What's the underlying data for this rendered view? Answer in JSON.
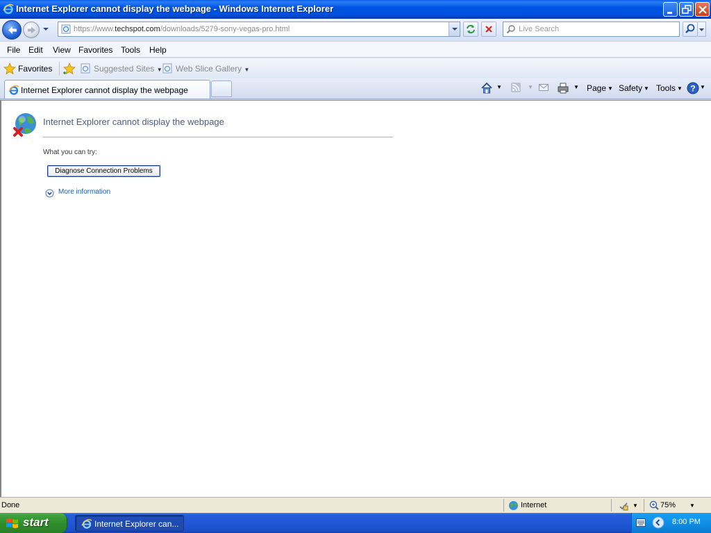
{
  "window": {
    "title": "Internet Explorer cannot display the webpage - Windows Internet Explorer"
  },
  "address": {
    "url_prefix": "https://www.",
    "url_domain": "techspot.com",
    "url_path": "/downloads/5279-sony-vegas-pro.html"
  },
  "search": {
    "placeholder": "Live Search"
  },
  "menu": {
    "items": [
      "File",
      "Edit",
      "View",
      "Favorites",
      "Tools",
      "Help"
    ]
  },
  "favorites_bar": {
    "favorites_label": "Favorites",
    "links": [
      "Suggested Sites",
      "Web Slice Gallery"
    ]
  },
  "tab": {
    "label": "Internet Explorer cannot display the webpage"
  },
  "command_bar": {
    "page_label": "Page",
    "safety_label": "Safety",
    "tools_label": "Tools"
  },
  "content": {
    "heading": "Internet Explorer cannot display the webpage",
    "what_you_can_try": "What you can try:",
    "diagnose_button": "Diagnose Connection Problems",
    "more_information": "More information"
  },
  "status": {
    "text": "Done",
    "zone": "Internet",
    "zoom": "75%"
  },
  "taskbar": {
    "start_label": "start",
    "task_label": "Internet Explorer can...",
    "clock": "8:00 PM"
  },
  "colors": {
    "titlebar": "#0054e3",
    "heading_text": "#4e5a86",
    "link": "#1a5fb4",
    "start_green": "#3c9d3a"
  }
}
